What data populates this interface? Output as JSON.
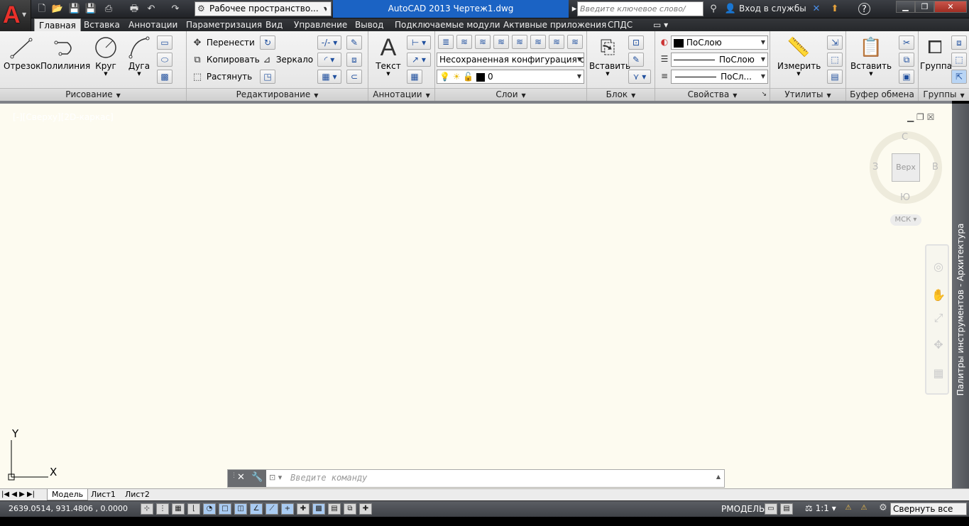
{
  "app": {
    "title": "AutoCAD 2013    Чертеж1.dwg",
    "workspace": "Рабочее пространство...",
    "search_placeholder": "Введите ключевое слово/фразу",
    "signin": "Вход в службы",
    "help": "?"
  },
  "tabs": [
    "Главная",
    "Вставка",
    "Аннотации",
    "Параметризация",
    "Вид",
    "Управление",
    "Вывод",
    "Подключаемые модули",
    "Активные приложения",
    "СПДС"
  ],
  "panels": {
    "draw": {
      "title": "Рисование",
      "line": "Отрезок",
      "polyline": "Полилиния",
      "circle": "Круг",
      "arc": "Дуга"
    },
    "modify": {
      "title": "Редактирование",
      "move": "Перенести",
      "copy": "Копировать",
      "stretch": "Растянуть",
      "mirror": "Зеркало"
    },
    "annotation": {
      "title": "Аннотации",
      "text": "Текст"
    },
    "layers": {
      "title": "Слои",
      "config": "Несохраненная конфигурация сло",
      "current": "0"
    },
    "block": {
      "title": "Блок",
      "insert": "Вставить"
    },
    "properties": {
      "title": "Свойства",
      "color": "ПоСлою",
      "linetype": "ПоСлою",
      "lineweight": "ПоСл..."
    },
    "utilities": {
      "title": "Утилиты",
      "measure": "Измерить"
    },
    "clipboard": {
      "title": "Буфер обмена",
      "paste": "Вставить"
    },
    "groups": {
      "title": "Группы",
      "group": "Группа"
    }
  },
  "viewport": {
    "control": "[-][Сверху][2D-каркас]",
    "viewcube": {
      "n": "С",
      "s": "Ю",
      "w": "З",
      "e": "В",
      "top": "Верх",
      "wcs": "МСК"
    },
    "ucs_x": "X",
    "ucs_y": "Y"
  },
  "palette_label": "Палитры инструментов - Архитектура",
  "command": {
    "placeholder": "Введите команду"
  },
  "layouts": [
    "Модель",
    "Лист1",
    "Лист2"
  ],
  "status": {
    "coords": "2639.0514, 931.4806 , 0.0000",
    "model": "РМОДЕЛЬ",
    "scale": "1:1",
    "collapse": "Свернуть все окна"
  }
}
